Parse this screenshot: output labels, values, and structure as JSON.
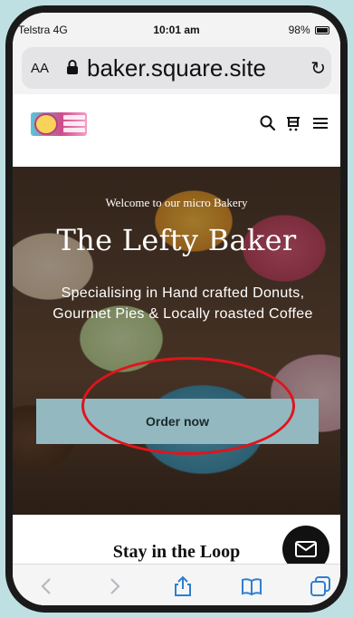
{
  "status": {
    "carrier": "Telstra  4G",
    "time": "10:01 am",
    "battery": "98%"
  },
  "browser": {
    "aa_label": "AA",
    "url": "baker.square.site",
    "reload_icon": "reload-icon",
    "lock_icon": "lock-icon"
  },
  "header": {
    "logo_icon": "logo-icon",
    "icons": [
      "search-icon",
      "cart-icon",
      "menu-icon"
    ]
  },
  "hero": {
    "welcome": "Welcome to our micro Bakery",
    "title": "The Lefty Baker",
    "subtitle": "Specialising in Hand crafted Donuts, Gourmet Pies & Locally roasted Coffee",
    "button": "Order now"
  },
  "newsletter": {
    "title": "Stay in the Loop",
    "input_placeholder": ""
  },
  "chat": {
    "icon": "mail-icon"
  },
  "toolbar": {
    "items": [
      "back-icon",
      "forward-icon",
      "share-icon",
      "bookmarks-icon",
      "tabs-icon"
    ]
  },
  "colors": {
    "accent": "#93b8c0",
    "page_bg": "#bfe0e2",
    "annotation": "#e0141c"
  }
}
